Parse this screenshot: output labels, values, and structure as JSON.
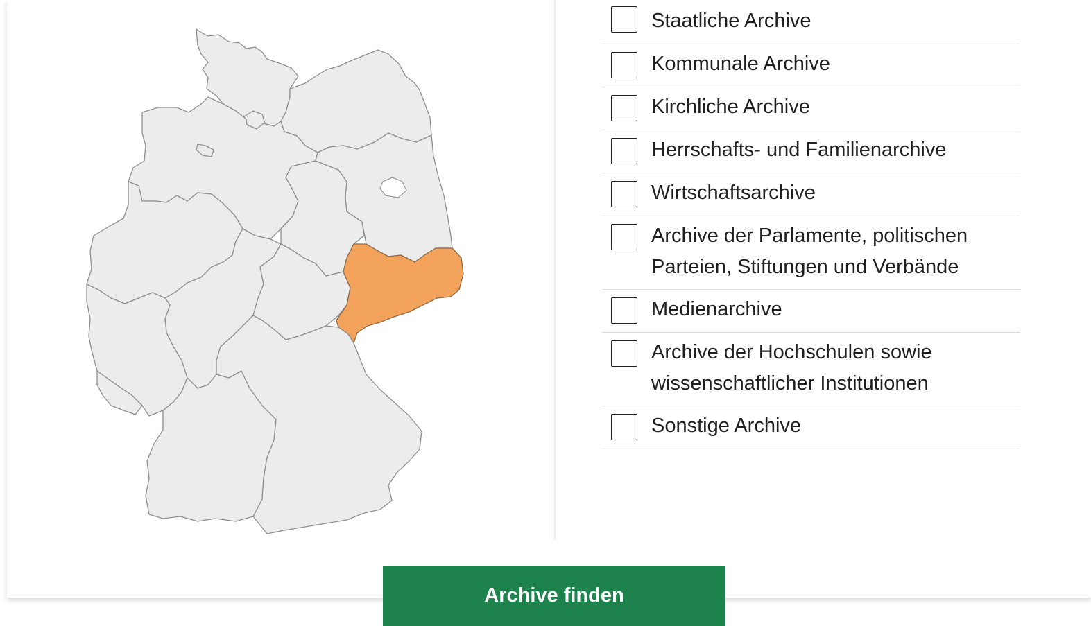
{
  "map": {
    "selected_state": "Sachsen",
    "colors": {
      "default_fill": "#ececec",
      "selected_fill": "#f2a25a",
      "border": "#8e8e8e"
    }
  },
  "filters": {
    "items": [
      {
        "label": "Staatliche Archive",
        "checked": false
      },
      {
        "label": "Kommunale Archive",
        "checked": false
      },
      {
        "label": "Kirchliche Archive",
        "checked": false
      },
      {
        "label": "Herrschafts- und Familienarchive",
        "checked": false
      },
      {
        "label": "Wirtschaftsarchive",
        "checked": false
      },
      {
        "label": "Archive der Parlamente, politischen Parteien, Stiftungen und Verbände",
        "checked": false
      },
      {
        "label": "Medienarchive",
        "checked": false
      },
      {
        "label": "Archive der Hochschulen sowie wissenschaftlicher Institutionen",
        "checked": false
      },
      {
        "label": "Sonstige Archive",
        "checked": false
      }
    ]
  },
  "submit": {
    "label": "Archive finden",
    "color": "#1e824c"
  }
}
